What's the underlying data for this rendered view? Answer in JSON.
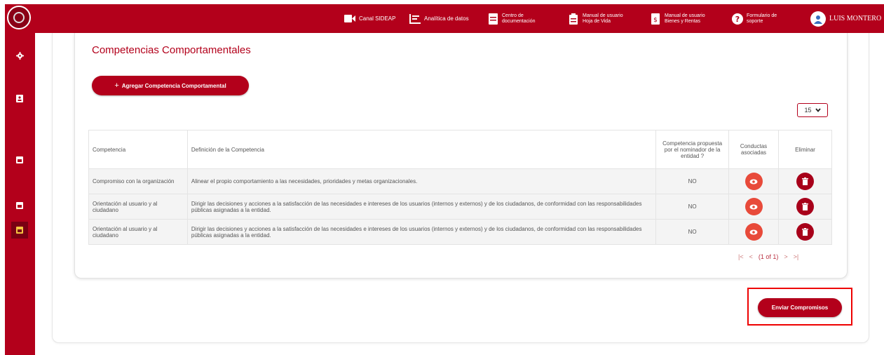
{
  "colors": {
    "brand": "#b3001b",
    "eye_button": "#e84a3a",
    "highlight_box": "#ee0000"
  },
  "topbar": {
    "items": [
      {
        "icon": "video-icon",
        "label": "Canal SIDEAP"
      },
      {
        "icon": "chart-icon",
        "label": "Analítica de datos"
      },
      {
        "icon": "document-icon",
        "line1": "Centro de",
        "line2": "documentación"
      },
      {
        "icon": "clipboard-icon",
        "line1": "Manual de usuario",
        "line2": "Hoja de Vida"
      },
      {
        "icon": "money-document-icon",
        "line1": "Manual de usuario",
        "line2": "Bienes y Rentas"
      },
      {
        "icon": "help-icon",
        "line1": "Formulario de",
        "line2": "soporte"
      }
    ],
    "user": "LUIS MONTERO"
  },
  "sidebar": {
    "icons": [
      "logo-icon",
      "gear-icon",
      "id-card-icon",
      "calendar-icon",
      "calendar-icon",
      "calendar-icon"
    ]
  },
  "section": {
    "title": "Competencias Comportamentales",
    "add_button": "Agregar Competencia Comportamental",
    "page_size": "15"
  },
  "table": {
    "headers": {
      "competencia": "Competencia",
      "definicion": "Definición de la Competencia",
      "propuesta": "Competencia propuesta por el nominador de la entidad ?",
      "conductas": "Conductas asociadas",
      "eliminar": "Eliminar"
    },
    "rows": [
      {
        "competencia": "Compromiso con la organización",
        "definicion": "Alinear el propio comportamiento a las necesidades, prioridades y metas organizacionales.",
        "propuesta": "NO"
      },
      {
        "competencia": "Orientación al usuario y al ciudadano",
        "definicion": "Dirigir las decisiones y acciones a la satisfacción de las necesidades e intereses de los usuarios (internos y externos) y de los ciudadanos, de conformidad con las responsabilidades públicas asignadas a la entidad.",
        "propuesta": "NO"
      },
      {
        "competencia": "Orientación al usuario y al ciudadano",
        "definicion": "Dirigir las decisiones y acciones a la satisfacción de las necesidades e intereses de los usuarios (internos y externos) y de los ciudadanos, de conformidad con las responsabilidades públicas asignadas a la entidad.",
        "propuesta": "NO"
      }
    ]
  },
  "pager": {
    "first": "|<",
    "prev": "<",
    "info": "(1 of 1)",
    "next": ">",
    "last": ">|"
  },
  "send_button": "Enviar Compromisos"
}
